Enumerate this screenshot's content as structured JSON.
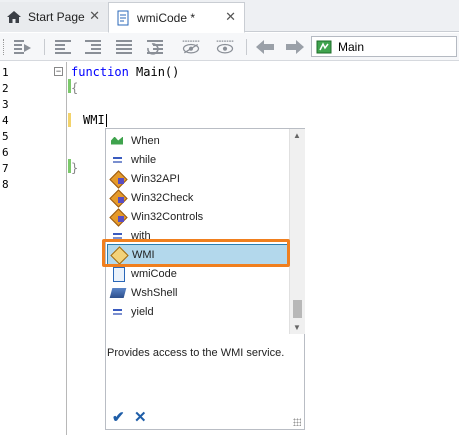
{
  "tabs": [
    {
      "label": "Start Page",
      "icon": "home-icon",
      "close": "✕"
    },
    {
      "label": "wmiCode *",
      "icon": "document-icon",
      "close": "✕"
    }
  ],
  "toolbar": {
    "combo_icon": "function-icon",
    "combo_value": "Main"
  },
  "editor": {
    "line_numbers": [
      "1",
      "2",
      "3",
      "4",
      "5",
      "6",
      "7",
      "8"
    ],
    "line1_keyword": "function",
    "line1_rest": " Main()",
    "line2": "{",
    "line4": "WMI",
    "line7": "}"
  },
  "completion": {
    "items": [
      {
        "label": "When",
        "icon": "snippet-icon"
      },
      {
        "label": "while",
        "icon": "keyword-icon"
      },
      {
        "label": "Win32API",
        "icon": "object-icon"
      },
      {
        "label": "Win32Check",
        "icon": "object-icon"
      },
      {
        "label": "Win32Controls",
        "icon": "object-icon"
      },
      {
        "label": "with",
        "icon": "keyword-icon"
      },
      {
        "label": "WMI",
        "icon": "wmi-object-icon",
        "selected": true
      },
      {
        "label": "wmiCode",
        "icon": "unit-icon"
      },
      {
        "label": "WshShell",
        "icon": "shell-object-icon"
      },
      {
        "label": "yield",
        "icon": "keyword-icon"
      }
    ],
    "description": "Provides access to the WMI service.",
    "ok_symbol": "✔",
    "cancel_symbol": "✕",
    "highlight_color": "#f07f1e"
  }
}
